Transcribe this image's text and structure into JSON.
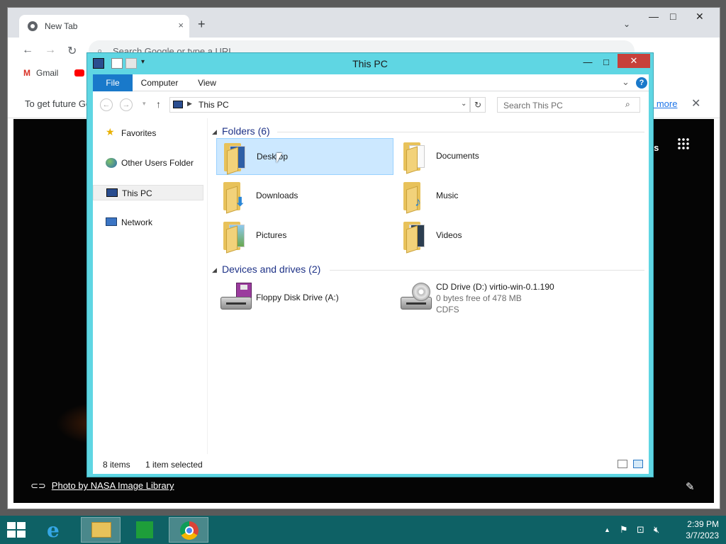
{
  "chrome": {
    "tab_title": "New Tab",
    "tab_close": "×",
    "new_tab": "+",
    "tab_search": "⌄",
    "minimize": "—",
    "maximize": "□",
    "close": "✕",
    "back": "←",
    "forward": "→",
    "reload": "↻",
    "omnibox_placeholder": "Search Google or type a URL",
    "bookmark_gmail": "Gmail",
    "info_text": "To get future Google Chrome updates",
    "info_link": "n more",
    "info_close": "✕",
    "ntp_fragment": "ges",
    "photo_credit": "Photo by NASA Image Library",
    "edit_icon": "✎"
  },
  "explorer": {
    "title": "This PC",
    "minimize": "—",
    "maximize": "□",
    "close": "✕",
    "ribbon_tabs": [
      "File",
      "Computer",
      "View"
    ],
    "ribbon_chevron": "⌄",
    "help": "?",
    "back": "←",
    "forward": "→",
    "up": "↑",
    "address": "This PC",
    "refresh": "↻",
    "search_placeholder": "Search This PC",
    "nav": [
      "Favorites",
      "Other Users Folder",
      "This PC",
      "Network"
    ],
    "folders_header": "Folders (6)",
    "folders": [
      "Desktop",
      "Documents",
      "Downloads",
      "Music",
      "Pictures",
      "Videos"
    ],
    "devices_header": "Devices and drives (2)",
    "floppy": "Floppy Disk Drive (A:)",
    "cd_name": "CD Drive (D:) virtio-win-0.1.190",
    "cd_free": "0 bytes free of 478 MB",
    "cd_fs": "CDFS",
    "status_count": "8 items",
    "status_selected": "1 item selected"
  },
  "taskbar": {
    "time": "2:39 PM",
    "date": "3/7/2023",
    "tray_chevron": "▲"
  },
  "colors": {
    "explorer_frame": "#5fd6e3",
    "file_tab": "#1979ca",
    "selection": "#cce8ff",
    "taskbar": "#0e6165",
    "close_red": "#c7403a"
  }
}
